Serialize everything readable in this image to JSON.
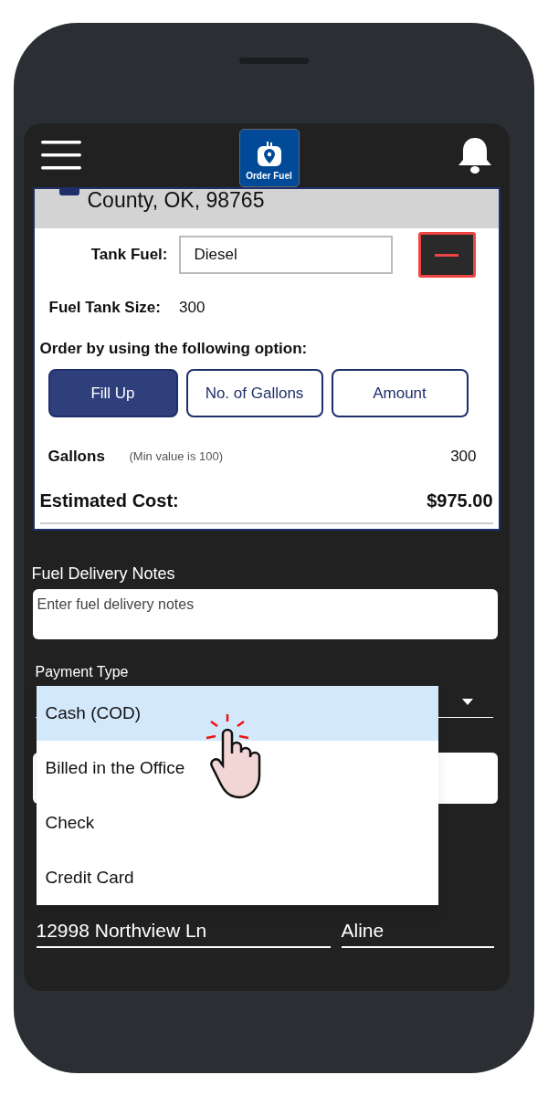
{
  "header": {
    "logo_text": "Order Fuel"
  },
  "address": {
    "text": "County, OK, 98765"
  },
  "tank_fuel": {
    "label": "Tank Fuel:",
    "value": "Diesel"
  },
  "tank_size": {
    "label": "Fuel Tank Size:",
    "value": "300"
  },
  "order_options": {
    "label": "Order by using the following option:",
    "options": [
      {
        "label": "Fill Up",
        "selected": true
      },
      {
        "label": "No. of Gallons",
        "selected": false
      },
      {
        "label": "Amount",
        "selected": false
      }
    ]
  },
  "gallons": {
    "label": "Gallons",
    "hint": "(Min value is 100)",
    "value": "300"
  },
  "estimated_cost": {
    "label": "Estimated Cost:",
    "value": "$975.00"
  },
  "notes": {
    "label": "Fuel Delivery Notes",
    "placeholder": "Enter fuel delivery notes"
  },
  "payment": {
    "label": "Payment Type",
    "expanded": true,
    "options": [
      {
        "label": "Cash (COD)",
        "selected": true
      },
      {
        "label": "Billed in the Office",
        "selected": false
      },
      {
        "label": "Check",
        "selected": false
      },
      {
        "label": "Credit Card",
        "selected": false
      }
    ]
  },
  "address_fields": [
    {
      "value": "12998 Northview Ln"
    },
    {
      "value": "Aline"
    }
  ]
}
